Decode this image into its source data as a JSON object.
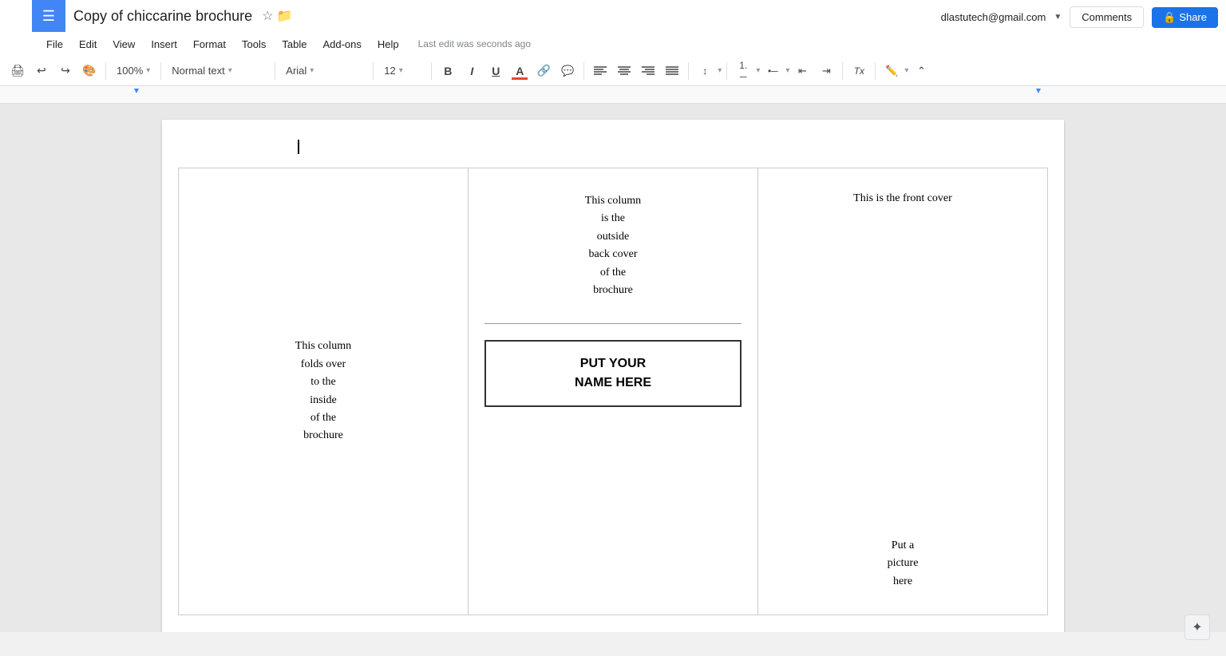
{
  "app": {
    "menu_icon": "≡",
    "title": "Copy of chiccarine brochure",
    "star_icon": "☆",
    "folder_icon": "📁",
    "user_email": "dlastutech@gmail.com",
    "dropdown_icon": "▼"
  },
  "menu": {
    "items": [
      "File",
      "Edit",
      "View",
      "Insert",
      "Format",
      "Tools",
      "Table",
      "Add-ons",
      "Help"
    ],
    "last_edit": "Last edit was seconds ago"
  },
  "toolbar": {
    "print_icon": "🖨",
    "undo_icon": "↩",
    "redo_icon": "↪",
    "paint_icon": "🎨",
    "zoom": "100%",
    "style": "Normal text",
    "font": "Arial",
    "size": "12",
    "bold": "B",
    "italic": "I",
    "underline": "U",
    "text_color": "A",
    "link_icon": "🔗",
    "comment_icon": "💬",
    "align_left": "≡",
    "align_center": "≡",
    "align_right": "≡",
    "align_justify": "≡",
    "line_spacing": "↕",
    "numbered_list": "1.",
    "bulleted_list": "•",
    "indent_less": "←",
    "indent_more": "→",
    "clear_format": "Tx",
    "pen_icon": "✏",
    "collapse_icon": "⌃"
  },
  "buttons": {
    "comments": "Comments",
    "share": "Share",
    "share_lock": "🔒"
  },
  "brochure": {
    "col1": {
      "line1": "This column",
      "line2": "folds over",
      "line3": "to the",
      "line4": "inside",
      "line5": "of the",
      "line6": "brochure"
    },
    "col2": {
      "top_line1": "This column",
      "top_line2": "is the",
      "top_line3": "outside",
      "top_line4": "back cover",
      "top_line5": "of the",
      "top_line6": "brochure",
      "name_line1": "PUT YOUR",
      "name_line2": "NAME HERE"
    },
    "col3": {
      "top_text": "This is the front cover",
      "pic_line1": "Put a",
      "pic_line2": "picture",
      "pic_line3": "here"
    }
  }
}
